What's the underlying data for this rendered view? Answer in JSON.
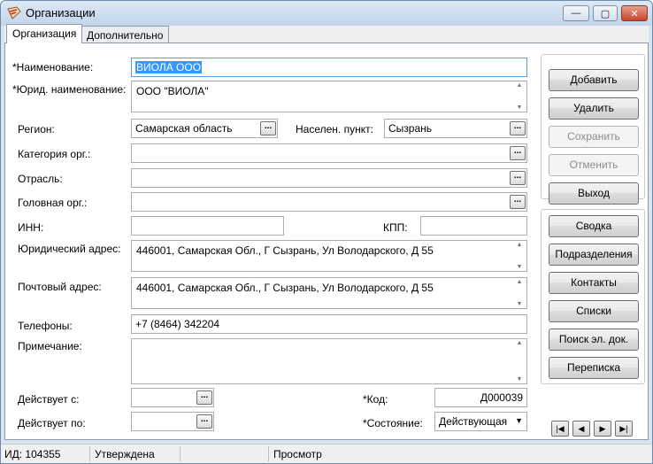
{
  "window": {
    "title": "Организации",
    "minimize_glyph": "—",
    "maximize_glyph": "▢",
    "close_glyph": "✕"
  },
  "tabs": [
    {
      "label": "Организация",
      "active": true
    },
    {
      "label": "Дополнительно",
      "active": false
    }
  ],
  "form": {
    "name_label": "*Наименование:",
    "name_value": "ВИОЛА ООО",
    "legal_name_label": "*Юрид. наименование:",
    "legal_name_value": "ООО \"ВИОЛА\"",
    "region_label": "Регион:",
    "region_value": "Самарская область",
    "locality_label": "Населен. пункт:",
    "locality_value": "Сызрань",
    "category_label": "Категория орг.:",
    "category_value": "",
    "industry_label": "Отрасль:",
    "industry_value": "",
    "parent_label": "Головная орг.:",
    "parent_value": "",
    "inn_label": "ИНН:",
    "inn_value": "",
    "kpp_label": "КПП:",
    "kpp_value": "",
    "legal_address_label": "Юридический адрес:",
    "legal_address_value": "446001, Самарская Обл., Г Сызрань, Ул Володарского, Д 55",
    "postal_address_label": "Почтовый адрес:",
    "postal_address_value": "446001, Самарская Обл., Г Сызрань, Ул Володарского, Д 55",
    "phones_label": "Телефоны:",
    "phones_value": "+7 (8464) 342204",
    "note_label": "Примечание:",
    "note_value": "",
    "valid_from_label": "Действует с:",
    "valid_from_value": "",
    "valid_to_label": "Действует по:",
    "valid_to_value": "",
    "code_label": "*Код:",
    "code_value": "Д000039",
    "status_label": "*Состояние:",
    "status_value": "Действующая",
    "ellipsis": "..."
  },
  "actions": {
    "add": "Добавить",
    "delete": "Удалить",
    "save": "Сохранить",
    "cancel": "Отменить",
    "exit": "Выход"
  },
  "links": {
    "summary": "Сводка",
    "departments": "Подразделения",
    "contacts": "Контакты",
    "lists": "Списки",
    "search_docs": "Поиск эл. док.",
    "correspondence": "Переписка"
  },
  "navigation": {
    "first": "|◀",
    "prev": "◀",
    "next": "▶",
    "last": "▶|"
  },
  "statusbar": {
    "id": "ИД: 104355",
    "approval": "Утверждена",
    "mode": "Просмотр"
  },
  "colors": {
    "selection": "#3399ff",
    "titlebar": "#c3d5ea",
    "close_button": "#c7462c"
  }
}
